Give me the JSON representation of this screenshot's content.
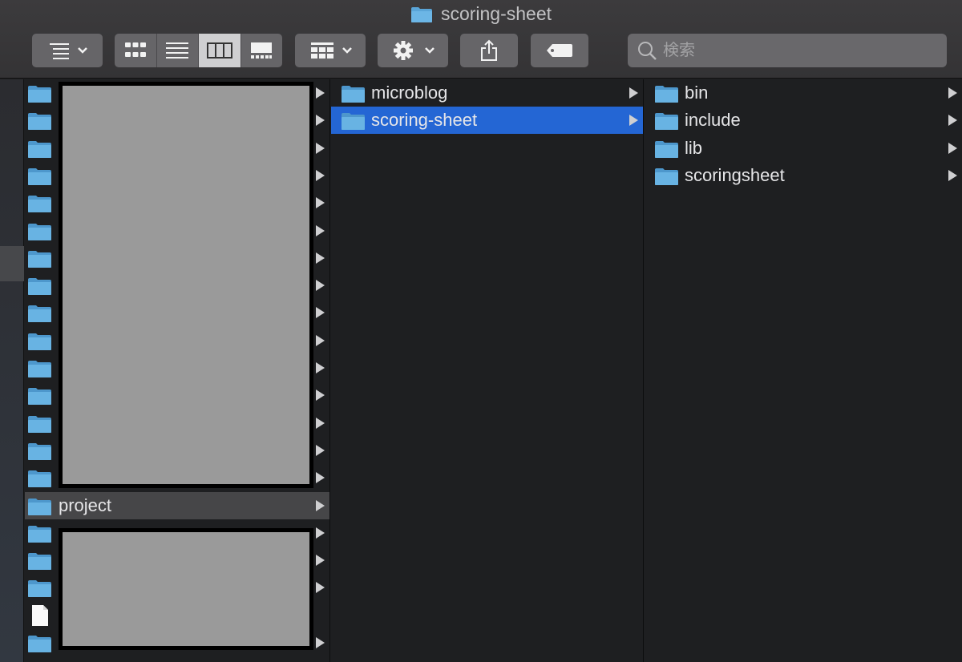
{
  "window": {
    "title": "scoring-sheet"
  },
  "toolbar": {
    "view_options_icon": "list-options-icon",
    "view_modes": [
      "icon-view-icon",
      "list-view-icon",
      "column-view-icon",
      "gallery-view-icon"
    ],
    "active_view": "column",
    "group_icon": "group-by-icon",
    "action_icon": "gear-icon",
    "share_icon": "share-icon",
    "tag_icon": "tag-icon",
    "search": {
      "placeholder": "検索",
      "value": ""
    }
  },
  "column1": {
    "selected": "project",
    "visible_labels": [
      "project"
    ]
  },
  "column2": {
    "items": [
      {
        "label": "microblog",
        "type": "folder",
        "selected": false
      },
      {
        "label": "scoring-sheet",
        "type": "folder",
        "selected": true
      }
    ]
  },
  "column3": {
    "items": [
      {
        "label": "bin",
        "type": "folder"
      },
      {
        "label": "include",
        "type": "folder"
      },
      {
        "label": "lib",
        "type": "folder"
      },
      {
        "label": "scoringsheet",
        "type": "folder"
      }
    ]
  },
  "colors": {
    "selection_blue": "#2466d4",
    "folder_blue": "#5aa5d8",
    "background": "#1e1f21"
  }
}
